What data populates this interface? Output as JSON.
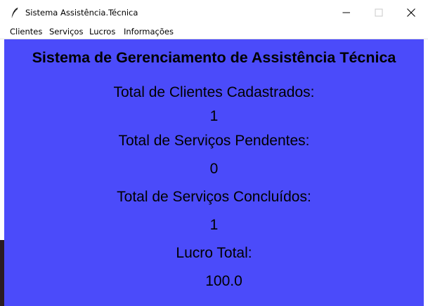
{
  "window": {
    "title": "Sistema Assistência.Técnica",
    "icon": "feather-icon"
  },
  "menu": {
    "items": [
      "Clientes",
      "Serviços",
      "Lucros",
      "Informações"
    ]
  },
  "main": {
    "background": "#4b4bfa",
    "heading": "Sistema de Gerenciamento de Assistência Técnica",
    "stats": [
      {
        "label": "Total de Clientes Cadastrados:",
        "value": "1"
      },
      {
        "label": "Total de Serviços Pendentes:",
        "value": "0"
      },
      {
        "label": "Total de Serviços Concluídos:",
        "value": "1"
      },
      {
        "label": "Lucro Total:",
        "value": "100.0"
      }
    ]
  }
}
